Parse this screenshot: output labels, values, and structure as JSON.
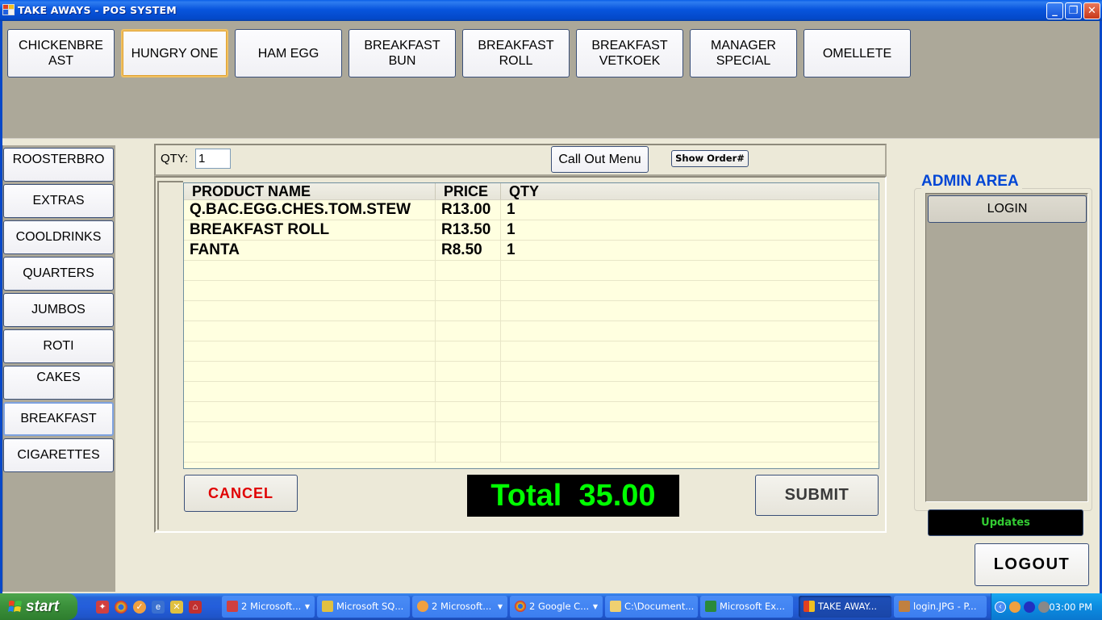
{
  "window": {
    "title": "TAKE AWAYS - POS SYSTEM",
    "controls": {
      "minimize": "_",
      "restore": "❐",
      "close": "✕"
    }
  },
  "menu_items": [
    {
      "label": "CHICKENBRE AST"
    },
    {
      "label": "HUNGRY ONE",
      "focused": true
    },
    {
      "label": "HAM EGG"
    },
    {
      "label": "BREAKFAST BUN"
    },
    {
      "label": "BREAKFAST ROLL"
    },
    {
      "label": "BREAKFAST VETKOEK"
    },
    {
      "label": "MANAGER SPECIAL"
    },
    {
      "label": "OMELLETE"
    }
  ],
  "categories": [
    {
      "label": "ROOSTERBRO"
    },
    {
      "label": "EXTRAS"
    },
    {
      "label": "COOLDRINKS"
    },
    {
      "label": "QUARTERS"
    },
    {
      "label": "JUMBOS"
    },
    {
      "label": "ROTI"
    },
    {
      "label": "CAKES"
    },
    {
      "label": "BREAKFAST",
      "selected": true
    },
    {
      "label": "CIGARETTES"
    }
  ],
  "order_bar": {
    "qty_label": "QTY:",
    "qty_value": "1",
    "call_out_menu": "Call Out Menu",
    "show_order": "Show Order#"
  },
  "order_grid": {
    "columns": [
      "PRODUCT NAME",
      "PRICE",
      "QTY"
    ],
    "rows": [
      [
        "Q.BAC.EGG.CHES.TOM.STEW",
        "R13.00",
        "1"
      ],
      [
        "BREAKFAST ROLL",
        "R13.50",
        "1"
      ],
      [
        "FANTA",
        "R8.50",
        "1"
      ],
      [
        "",
        "",
        ""
      ],
      [
        "",
        "",
        ""
      ],
      [
        "",
        "",
        ""
      ],
      [
        "",
        "",
        ""
      ],
      [
        "",
        "",
        ""
      ],
      [
        "",
        "",
        ""
      ],
      [
        "",
        "",
        ""
      ],
      [
        "",
        "",
        ""
      ],
      [
        "",
        "",
        ""
      ],
      [
        "",
        "",
        ""
      ]
    ]
  },
  "actions": {
    "cancel": "CANCEL",
    "total": "Total  35.00",
    "submit": "SUBMIT"
  },
  "admin": {
    "title": "ADMIN AREA",
    "login": "LOGIN",
    "updates": "Updates",
    "logout": "LOGOUT"
  },
  "taskbar": {
    "start": "start",
    "quick_launch": [
      "ms-office-icon",
      "chrome-icon",
      "outlook-icon",
      "ie-icon",
      "sql-tools-icon",
      "app-icon"
    ],
    "tasks": [
      {
        "label": "2 Microsoft...",
        "group": true,
        "icon": "ms-office-icon"
      },
      {
        "label": "Microsoft SQ...",
        "icon": "sql-tools-icon"
      },
      {
        "label": "2 Microsoft...",
        "group": true,
        "icon": "outlook-icon"
      },
      {
        "label": "2 Google C...",
        "group": true,
        "icon": "chrome-icon"
      },
      {
        "label": "C:\\Document...",
        "icon": "folder-icon"
      },
      {
        "label": "Microsoft Ex...",
        "icon": "excel-icon"
      },
      {
        "label": "TAKE AWAY...",
        "active": true,
        "icon": "pos-app-icon"
      },
      {
        "label": "login.JPG - P...",
        "icon": "paint-icon"
      }
    ],
    "clock": "03:00 PM"
  },
  "colors": {
    "title_blue": "#0855dd",
    "panel_gray": "#aca899",
    "form_bg": "#ece9d8",
    "grid_bg": "#ffffe0",
    "cancel_red": "#e00000",
    "total_green": "#00ff00",
    "admin_blue": "#0046d5"
  }
}
